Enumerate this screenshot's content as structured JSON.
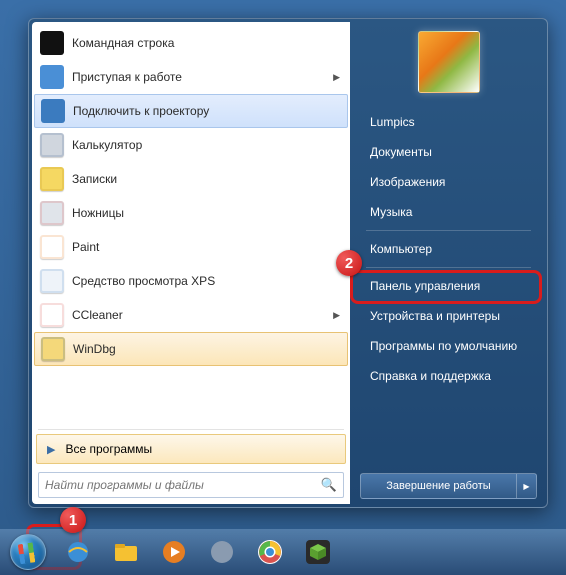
{
  "programs": [
    {
      "label": "Командная строка",
      "icon_bg": "#111",
      "icon_fg": "#eee",
      "expand": false,
      "state": ""
    },
    {
      "label": "Приступая к работе",
      "icon_bg": "#4a8fd6",
      "icon_fg": "#fff",
      "expand": true,
      "state": ""
    },
    {
      "label": "Подключить к проектору",
      "icon_bg": "#3b7bbf",
      "icon_fg": "#fff",
      "expand": false,
      "state": "sel"
    },
    {
      "label": "Калькулятор",
      "icon_bg": "#d0d6de",
      "icon_fg": "#4a6a94",
      "expand": false,
      "state": ""
    },
    {
      "label": "Записки",
      "icon_bg": "#f5d862",
      "icon_fg": "#b89020",
      "expand": false,
      "state": ""
    },
    {
      "label": "Ножницы",
      "icon_bg": "#e0e4ea",
      "icon_fg": "#d9534f",
      "expand": false,
      "state": ""
    },
    {
      "label": "Paint",
      "icon_bg": "#fff",
      "icon_fg": "#e67e22",
      "expand": false,
      "state": ""
    },
    {
      "label": "Средство просмотра XPS",
      "icon_bg": "#eef3f9",
      "icon_fg": "#5a8fc7",
      "expand": false,
      "state": ""
    },
    {
      "label": "CCleaner",
      "icon_bg": "#fff",
      "icon_fg": "#d9534f",
      "expand": true,
      "state": ""
    },
    {
      "label": "WinDbg",
      "icon_bg": "#f4d87a",
      "icon_fg": "#2a5a9c",
      "expand": false,
      "state": "hot"
    }
  ],
  "all_programs": "Все программы",
  "search_placeholder": "Найти программы и файлы",
  "right_items": [
    "Lumpics",
    "Документы",
    "Изображения",
    "Музыка",
    "—",
    "Компьютер",
    "—",
    "Панель управления",
    "Устройства и принтеры",
    "Программы по умолчанию",
    "Справка и поддержка"
  ],
  "shutdown_label": "Завершение работы",
  "badges": {
    "start": "1",
    "control_panel": "2"
  }
}
